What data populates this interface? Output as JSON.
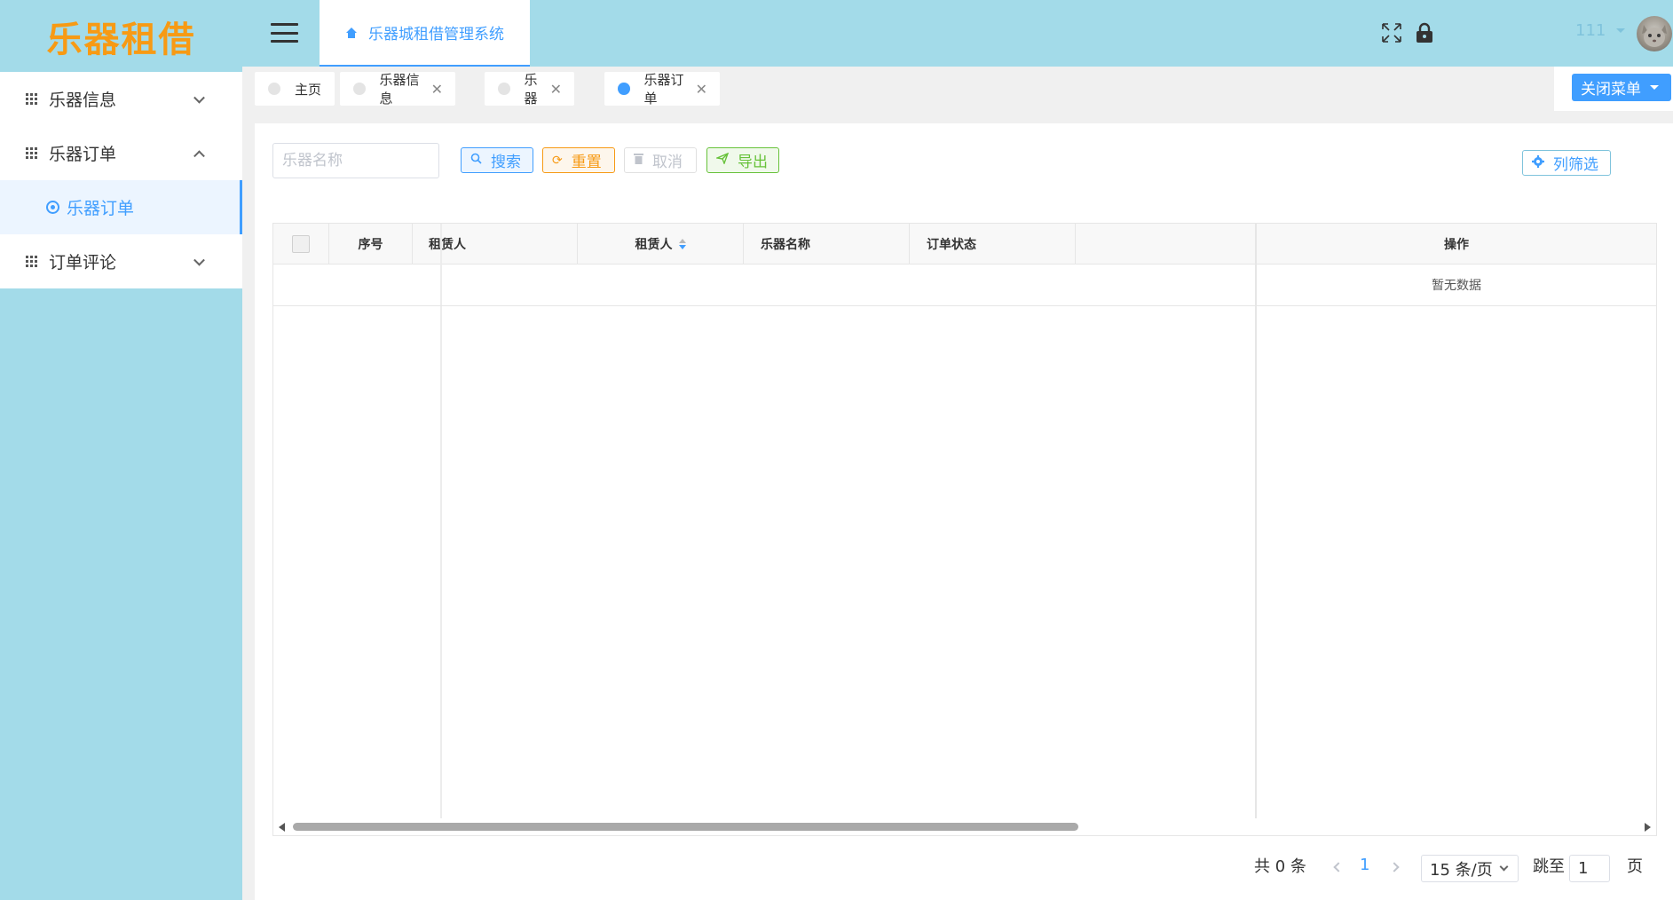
{
  "app": {
    "logo_text": "乐器租借"
  },
  "sidebar": {
    "items": [
      {
        "label": "乐器信息",
        "expanded": false
      },
      {
        "label": "乐器订单",
        "expanded": true,
        "children": [
          {
            "label": "乐器订单",
            "active": true
          }
        ]
      },
      {
        "label": "订单评论",
        "expanded": false
      }
    ]
  },
  "header": {
    "breadcrumb": "乐器城租借管理系统",
    "username": "111"
  },
  "tags": [
    {
      "label": "主页",
      "active": false,
      "closable": false
    },
    {
      "label": "乐器信息",
      "active": false,
      "closable": true
    },
    {
      "label": "乐器",
      "active": false,
      "closable": true
    },
    {
      "label": "乐器订单",
      "active": true,
      "closable": true
    }
  ],
  "close_menu": {
    "label": "关闭菜单"
  },
  "toolbar": {
    "search_placeholder": "乐器名称",
    "search_label": "搜索",
    "reset_label": "重置",
    "cancel_label": "取消",
    "export_label": "导出",
    "columns_label": "列筛选"
  },
  "table": {
    "columns": [
      "序号",
      "租赁人",
      "租赁人",
      "乐器名称",
      "订单状态",
      "操作"
    ],
    "empty_text": "暂无数据"
  },
  "pagination": {
    "total_text": "共 0 条",
    "current_page": "1",
    "page_size": "15 条/页",
    "jump_label": "跳至",
    "jump_value": "1",
    "page_suffix": "页"
  },
  "colors": {
    "sidebar_bg": "#a3dbe9",
    "logo": "#f79a14",
    "primary": "#409eff",
    "reset": "#f79a14",
    "export": "#67c23a"
  }
}
